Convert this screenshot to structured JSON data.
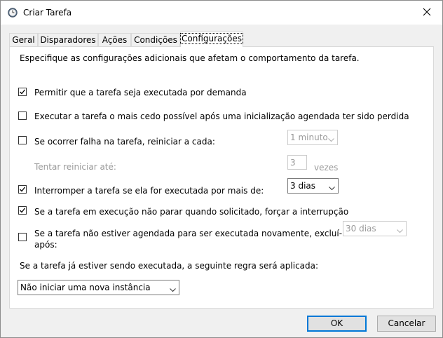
{
  "window": {
    "title": "Criar Tarefa",
    "icon": "clock-icon",
    "close_icon": "close-icon"
  },
  "tabs": [
    {
      "label": "Geral",
      "active": false
    },
    {
      "label": "Disparadores",
      "active": false
    },
    {
      "label": "Ações",
      "active": false
    },
    {
      "label": "Condições",
      "active": false
    },
    {
      "label": "Configurações",
      "active": true
    }
  ],
  "settings": {
    "description": "Especifique as configurações adicionais que afetam o comportamento da tarefa.",
    "options": [
      {
        "label": "Permitir que a tarefa seja executada por demanda",
        "checked": true
      },
      {
        "label": "Executar a tarefa o mais cedo possível após uma inicialização agendada ter sido perdida",
        "checked": false
      },
      {
        "label": "Se ocorrer falha na tarefa, reiniciar a cada:",
        "checked": false
      },
      {
        "label": "Interromper a tarefa se ela for executada por mais de:",
        "checked": true
      },
      {
        "label": "Se a tarefa em execução não parar quando solicitado, forçar a interrupção",
        "checked": true
      },
      {
        "label_line1": "Se a tarefa não estiver agendada para ser executada novamente, excluí-la",
        "label_line2": "após:",
        "checked": false
      }
    ],
    "restart_interval": {
      "value": "1 minuto",
      "enabled": false
    },
    "retry_label": "Tentar reiniciar até:",
    "retry_count": {
      "value": "3",
      "enabled": false
    },
    "retry_unit": "vezes",
    "stop_after": {
      "value": "3 dias",
      "enabled": true
    },
    "delete_after": {
      "value": "30 dias",
      "enabled": false
    },
    "rule_label": "Se a tarefa já estiver sendo executada, a seguinte regra será aplicada:",
    "rule_select": {
      "value": "Não iniciar uma nova instância"
    }
  },
  "buttons": {
    "ok": "OK",
    "cancel": "Cancelar"
  },
  "colors": {
    "accent": "#0078d7",
    "panel_bg": "#ffffff",
    "window_bg": "#f0f0f0",
    "disabled_text": "#9a9a9a"
  }
}
